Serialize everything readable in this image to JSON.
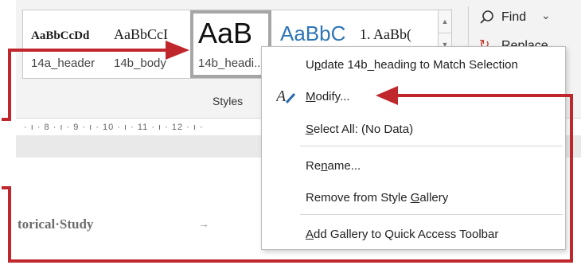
{
  "ribbon": {
    "styles_group_label": "Styles",
    "style_gallery": [
      {
        "preview": "AaBbCcDd",
        "name": "14a_header"
      },
      {
        "preview": "AaBbCcI",
        "name": "14b_body"
      },
      {
        "preview": "AaB",
        "name": "14b_headi..."
      },
      {
        "preview": "AaBbC",
        "name": ""
      },
      {
        "preview": "1.  AaBb(",
        "name": ""
      }
    ],
    "find_label": "Find",
    "replace_label": "Replace"
  },
  "ruler": {
    "text": "· ı · 8 · ı · 9 · ı · 10 · ı · 11 · ı · 12 · ı ·"
  },
  "document": {
    "text": "torical·Study",
    "tab_arrow": "→"
  },
  "context_menu": {
    "items": [
      {
        "pre": "U",
        "ul": "p",
        "post": "date 14b_heading to Match Selection"
      },
      {
        "pre": "",
        "ul": "M",
        "post": "odify..."
      },
      {
        "pre": "",
        "ul": "S",
        "post": "elect All: (No Data)"
      },
      {
        "pre": "Re",
        "ul": "n",
        "post": "ame..."
      },
      {
        "pre": "Remove from Style ",
        "ul": "G",
        "post": "allery"
      },
      {
        "pre": "",
        "ul": "A",
        "post": "dd Gallery to Quick Access Toolbar"
      }
    ]
  },
  "colors": {
    "annotation_red": "#c0272d",
    "heading_blue": "#2e75b6",
    "ribbon_bg": "#f3f3f3"
  },
  "icons": [
    "modify-style-icon",
    "find-magnifier-icon",
    "replace-icon",
    "scroll-up-icon",
    "scroll-down-icon"
  ]
}
